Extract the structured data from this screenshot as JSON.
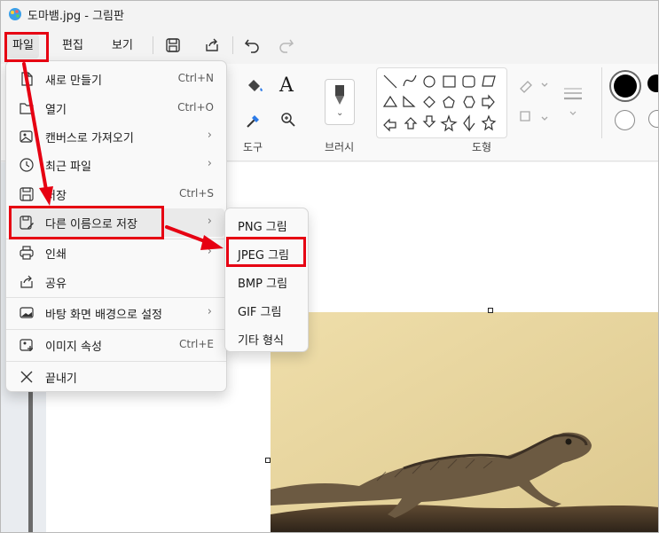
{
  "window": {
    "title": "도마뱀.jpg - 그림판"
  },
  "menubar": {
    "file": "파일",
    "edit": "편집",
    "view": "보기"
  },
  "ribbon": {
    "tools_label": "도구",
    "brush_label": "브러시",
    "shapes_label": "도형",
    "text_tool": "A"
  },
  "file_menu": {
    "new": {
      "label": "새로 만들기",
      "shortcut": "Ctrl+N"
    },
    "open": {
      "label": "열기",
      "shortcut": "Ctrl+O"
    },
    "import_canvas": {
      "label": "캔버스로 가져오기"
    },
    "recent": {
      "label": "최근 파일"
    },
    "save": {
      "label": "저장",
      "shortcut": "Ctrl+S"
    },
    "save_as": {
      "label": "다른 이름으로 저장"
    },
    "print": {
      "label": "인쇄"
    },
    "share": {
      "label": "공유"
    },
    "set_wallpaper": {
      "label": "바탕 화면 배경으로 설정"
    },
    "properties": {
      "label": "이미지 속성",
      "shortcut": "Ctrl+E"
    },
    "exit": {
      "label": "끝내기"
    },
    "chevron": "›"
  },
  "save_as_menu": {
    "png": "PNG 그림",
    "jpeg": "JPEG 그림",
    "bmp": "BMP 그림",
    "gif": "GIF 그림",
    "other": "기타 형식"
  },
  "colors": {
    "annotation_red": "#e60012",
    "color1": "#000000",
    "color2": "#ffffff",
    "photo_background": "#e8d7a0"
  }
}
